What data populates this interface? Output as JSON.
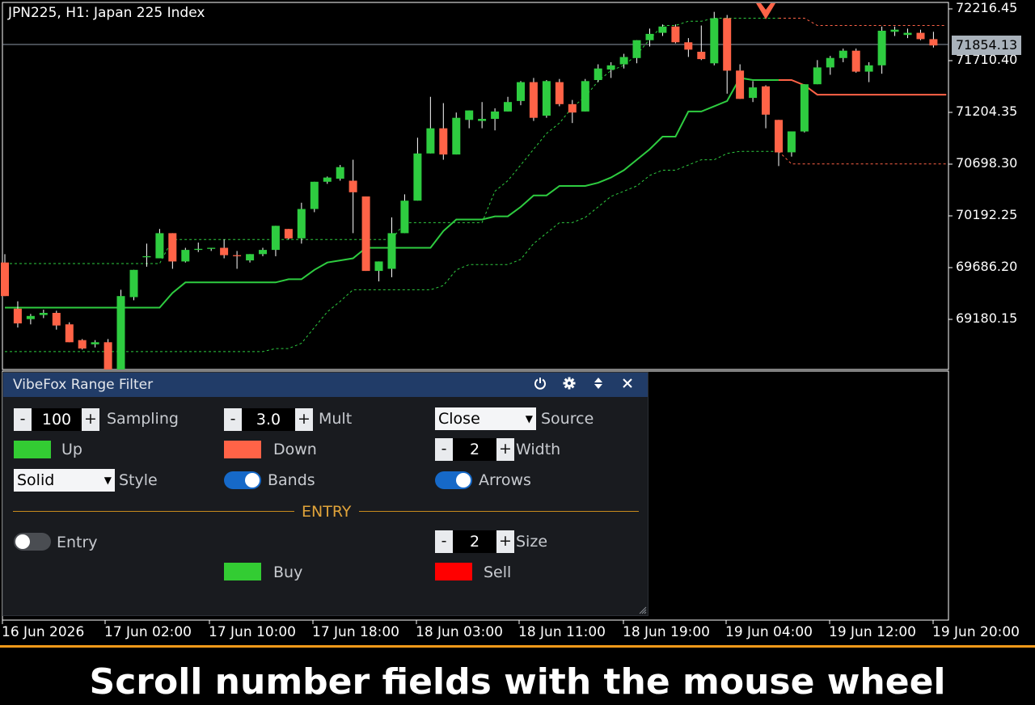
{
  "chart": {
    "title": "JPN225, H1:  Japan 225 Index",
    "current_price": "71854.13",
    "price_axis": [
      "72216.45",
      "71710.40",
      "71204.35",
      "70698.30",
      "70192.25",
      "69686.20",
      "69180.15"
    ],
    "time_axis": [
      "16 Jun 2026",
      "17 Jun 02:00",
      "17 Jun 10:00",
      "17 Jun 18:00",
      "18 Jun 03:00",
      "18 Jun 11:00",
      "18 Jun 19:00",
      "19 Jun 04:00",
      "19 Jun 12:00",
      "19 Jun 20:00"
    ],
    "colors": {
      "up": "#2ecc40",
      "down": "#ff6347",
      "band_up": "#2ecc40",
      "band_down": "#ff6347",
      "bg": "#000000"
    }
  },
  "chart_data": {
    "type": "candlestick",
    "y_range": [
      68800,
      72300
    ],
    "candles": [
      {
        "o": 69820,
        "h": 69900,
        "l": 69500,
        "c": 69500
      },
      {
        "o": 69380,
        "h": 69450,
        "l": 69200,
        "c": 69240
      },
      {
        "o": 69280,
        "h": 69330,
        "l": 69230,
        "c": 69310
      },
      {
        "o": 69320,
        "h": 69370,
        "l": 69290,
        "c": 69340
      },
      {
        "o": 69340,
        "h": 69360,
        "l": 69180,
        "c": 69220
      },
      {
        "o": 69230,
        "h": 69250,
        "l": 69060,
        "c": 69060
      },
      {
        "o": 69080,
        "h": 69090,
        "l": 68990,
        "c": 69000
      },
      {
        "o": 69040,
        "h": 69080,
        "l": 69010,
        "c": 69060
      },
      {
        "o": 69060,
        "h": 69090,
        "l": 68800,
        "c": 68800
      },
      {
        "o": 68800,
        "h": 69560,
        "l": 68800,
        "c": 69500
      },
      {
        "o": 69490,
        "h": 69750,
        "l": 69460,
        "c": 69750
      },
      {
        "o": 69870,
        "h": 70000,
        "l": 69780,
        "c": 69880
      },
      {
        "o": 69860,
        "h": 70140,
        "l": 69860,
        "c": 70100
      },
      {
        "o": 70100,
        "h": 70100,
        "l": 69760,
        "c": 69830
      },
      {
        "o": 69830,
        "h": 69960,
        "l": 69820,
        "c": 69940
      },
      {
        "o": 69940,
        "h": 70010,
        "l": 69920,
        "c": 69950
      },
      {
        "o": 69950,
        "h": 69960,
        "l": 69930,
        "c": 69960
      },
      {
        "o": 69960,
        "h": 70040,
        "l": 69860,
        "c": 69890
      },
      {
        "o": 69890,
        "h": 69930,
        "l": 69760,
        "c": 69880
      },
      {
        "o": 69840,
        "h": 69900,
        "l": 69820,
        "c": 69900
      },
      {
        "o": 69900,
        "h": 69960,
        "l": 69880,
        "c": 69940
      },
      {
        "o": 69940,
        "h": 70170,
        "l": 69880,
        "c": 70170
      },
      {
        "o": 70140,
        "h": 70140,
        "l": 70040,
        "c": 70050
      },
      {
        "o": 70050,
        "h": 70390,
        "l": 70000,
        "c": 70330
      },
      {
        "o": 70330,
        "h": 70590,
        "l": 70300,
        "c": 70590
      },
      {
        "o": 70590,
        "h": 70640,
        "l": 70570,
        "c": 70630
      },
      {
        "o": 70620,
        "h": 70750,
        "l": 70600,
        "c": 70730
      },
      {
        "o": 70600,
        "h": 70800,
        "l": 70100,
        "c": 70490
      },
      {
        "o": 70450,
        "h": 70450,
        "l": 69740,
        "c": 69740
      },
      {
        "o": 69740,
        "h": 69830,
        "l": 69640,
        "c": 69830
      },
      {
        "o": 69760,
        "h": 70250,
        "l": 69680,
        "c": 70100
      },
      {
        "o": 70100,
        "h": 70470,
        "l": 70100,
        "c": 70410
      },
      {
        "o": 70410,
        "h": 71010,
        "l": 70410,
        "c": 70860
      },
      {
        "o": 70860,
        "h": 71400,
        "l": 70860,
        "c": 71100
      },
      {
        "o": 71100,
        "h": 71340,
        "l": 70800,
        "c": 70850
      },
      {
        "o": 70850,
        "h": 71250,
        "l": 70850,
        "c": 71200
      },
      {
        "o": 71180,
        "h": 71270,
        "l": 71100,
        "c": 71270
      },
      {
        "o": 71170,
        "h": 71350,
        "l": 71100,
        "c": 71190
      },
      {
        "o": 71190,
        "h": 71290,
        "l": 71080,
        "c": 71260
      },
      {
        "o": 71260,
        "h": 71400,
        "l": 71260,
        "c": 71350
      },
      {
        "o": 71360,
        "h": 71550,
        "l": 71320,
        "c": 71540
      },
      {
        "o": 71540,
        "h": 71580,
        "l": 71170,
        "c": 71200
      },
      {
        "o": 71220,
        "h": 71560,
        "l": 71200,
        "c": 71550
      },
      {
        "o": 71540,
        "h": 71570,
        "l": 71310,
        "c": 71330
      },
      {
        "o": 71330,
        "h": 71370,
        "l": 71150,
        "c": 71250
      },
      {
        "o": 71260,
        "h": 71570,
        "l": 71260,
        "c": 71550
      },
      {
        "o": 71560,
        "h": 71710,
        "l": 71540,
        "c": 71670
      },
      {
        "o": 71660,
        "h": 71730,
        "l": 71580,
        "c": 71700
      },
      {
        "o": 71710,
        "h": 71810,
        "l": 71670,
        "c": 71780
      },
      {
        "o": 71770,
        "h": 71940,
        "l": 71720,
        "c": 71940
      },
      {
        "o": 71940,
        "h": 72050,
        "l": 71880,
        "c": 72000
      },
      {
        "o": 72010,
        "h": 72090,
        "l": 71980,
        "c": 72070
      },
      {
        "o": 72070,
        "h": 72090,
        "l": 71910,
        "c": 71920
      },
      {
        "o": 71920,
        "h": 71960,
        "l": 71780,
        "c": 71850
      },
      {
        "o": 71830,
        "h": 72080,
        "l": 71750,
        "c": 71760
      },
      {
        "o": 71720,
        "h": 72210,
        "l": 71700,
        "c": 72150
      },
      {
        "o": 72150,
        "h": 72180,
        "l": 71430,
        "c": 71650
      },
      {
        "o": 71650,
        "h": 71710,
        "l": 71380,
        "c": 71380
      },
      {
        "o": 71390,
        "h": 71550,
        "l": 71350,
        "c": 71490
      },
      {
        "o": 71500,
        "h": 71510,
        "l": 71100,
        "c": 71230
      },
      {
        "o": 71180,
        "h": 71180,
        "l": 70740,
        "c": 70870
      },
      {
        "o": 70870,
        "h": 71070,
        "l": 70830,
        "c": 71070
      },
      {
        "o": 71070,
        "h": 71520,
        "l": 71060,
        "c": 71520
      },
      {
        "o": 71520,
        "h": 71750,
        "l": 71520,
        "c": 71680
      },
      {
        "o": 71680,
        "h": 71790,
        "l": 71610,
        "c": 71770
      },
      {
        "o": 71770,
        "h": 71860,
        "l": 71730,
        "c": 71840
      },
      {
        "o": 71840,
        "h": 71860,
        "l": 71630,
        "c": 71640
      },
      {
        "o": 71640,
        "h": 71730,
        "l": 71540,
        "c": 71700
      },
      {
        "o": 71700,
        "h": 72070,
        "l": 71620,
        "c": 72030
      },
      {
        "o": 72020,
        "h": 72070,
        "l": 71980,
        "c": 72040
      },
      {
        "o": 71990,
        "h": 72050,
        "l": 71960,
        "c": 72010
      },
      {
        "o": 72010,
        "h": 72040,
        "l": 71940,
        "c": 71950
      },
      {
        "o": 71950,
        "h": 72020,
        "l": 71870,
        "c": 71890
      }
    ],
    "filter_line": [
      69390,
      69390,
      69390,
      69390,
      69390,
      69390,
      69390,
      69390,
      69390,
      69390,
      69390,
      69390,
      69390,
      69530,
      69630,
      69630,
      69630,
      69630,
      69630,
      69630,
      69630,
      69630,
      69660,
      69660,
      69750,
      69820,
      69840,
      69860,
      69960,
      69960,
      69960,
      69960,
      69960,
      69960,
      70120,
      70230,
      70230,
      70230,
      70260,
      70260,
      70350,
      70460,
      70460,
      70550,
      70550,
      70550,
      70580,
      70630,
      70700,
      70800,
      70900,
      71020,
      71020,
      71260,
      71260,
      71310,
      71360,
      71580,
      71560,
      71560,
      71560,
      71560,
      71510,
      71420,
      71420,
      71420,
      71420,
      71420,
      71420,
      71420,
      71420,
      71420,
      71420,
      71420
    ],
    "filter_direction": [
      "up",
      "up",
      "up",
      "up",
      "up",
      "up",
      "up",
      "up",
      "up",
      "up",
      "up",
      "up",
      "up",
      "up",
      "up",
      "up",
      "up",
      "up",
      "up",
      "up",
      "up",
      "up",
      "up",
      "up",
      "up",
      "up",
      "up",
      "up",
      "up",
      "up",
      "up",
      "up",
      "up",
      "up",
      "up",
      "up",
      "up",
      "up",
      "up",
      "up",
      "up",
      "up",
      "up",
      "up",
      "up",
      "up",
      "up",
      "up",
      "up",
      "up",
      "up",
      "up",
      "up",
      "up",
      "up",
      "up",
      "up",
      "up",
      "up",
      "up",
      "down",
      "down",
      "down",
      "down",
      "down",
      "down",
      "down",
      "down",
      "down",
      "down",
      "down",
      "down",
      "down",
      "down"
    ],
    "upper_band": [
      69810,
      69810,
      69810,
      69810,
      69810,
      69810,
      69810,
      69810,
      69810,
      69810,
      69810,
      69810,
      69810,
      70040,
      70040,
      70040,
      70040,
      70040,
      70040,
      70040,
      70040,
      70040,
      70040,
      70040,
      70040,
      70040,
      70040,
      70040,
      70040,
      70040,
      70040,
      70200,
      70200,
      70200,
      70200,
      70200,
      70200,
      70200,
      70500,
      70600,
      70750,
      70900,
      71050,
      71150,
      71300,
      71400,
      71550,
      71650,
      71700,
      71800,
      71950,
      72080,
      72080,
      72120,
      72120,
      72150,
      72150,
      72150,
      72150,
      72150,
      72150,
      72150,
      72150,
      72080,
      72080,
      72080,
      72080,
      72080,
      72080,
      72080,
      72080,
      72080,
      72080,
      72080
    ],
    "lower_band": [
      68970,
      68970,
      68970,
      68970,
      68970,
      68970,
      68970,
      68970,
      68970,
      68970,
      68970,
      68970,
      68970,
      68970,
      68970,
      68970,
      68970,
      68970,
      68970,
      68970,
      68970,
      69000,
      69000,
      69050,
      69200,
      69350,
      69450,
      69560,
      69560,
      69560,
      69560,
      69560,
      69560,
      69560,
      69600,
      69750,
      69800,
      69800,
      69800,
      69800,
      69850,
      70000,
      70100,
      70200,
      70200,
      70250,
      70350,
      70450,
      70500,
      70550,
      70650,
      70700,
      70700,
      70750,
      70800,
      70800,
      70860,
      70880,
      70880,
      70880,
      70880,
      70760,
      70760,
      70760,
      70760,
      70760,
      70760,
      70760,
      70760,
      70760,
      70760,
      70760,
      70760,
      70760
    ],
    "signal_arrow": {
      "index": 59,
      "direction": "sell"
    }
  },
  "panel": {
    "title": "VibeFox Range Filter",
    "icons": [
      "power-icon",
      "gear-icon",
      "move-icon",
      "close-icon"
    ],
    "sampling": {
      "value": "100",
      "label": "Sampling"
    },
    "mult": {
      "value": "3.0",
      "label": "Mult"
    },
    "source": {
      "value": "Close",
      "label": "Source"
    },
    "up": {
      "label": "Up",
      "color": "#33cc33"
    },
    "down": {
      "label": "Down",
      "color": "#ff6347"
    },
    "width": {
      "value": "2",
      "label": "Width"
    },
    "style": {
      "value": "Solid",
      "label": "Style"
    },
    "bands": {
      "label": "Bands",
      "on": true
    },
    "arrows": {
      "label": "Arrows",
      "on": true
    },
    "section": "ENTRY",
    "entry": {
      "label": "Entry",
      "on": false
    },
    "size": {
      "value": "2",
      "label": "Size"
    },
    "buy": {
      "label": "Buy",
      "color": "#33cc33"
    },
    "sell": {
      "label": "Sell",
      "color": "#ff0000"
    },
    "minus": "-",
    "plus": "+"
  },
  "caption": "Scroll number fields with the mouse wheel"
}
